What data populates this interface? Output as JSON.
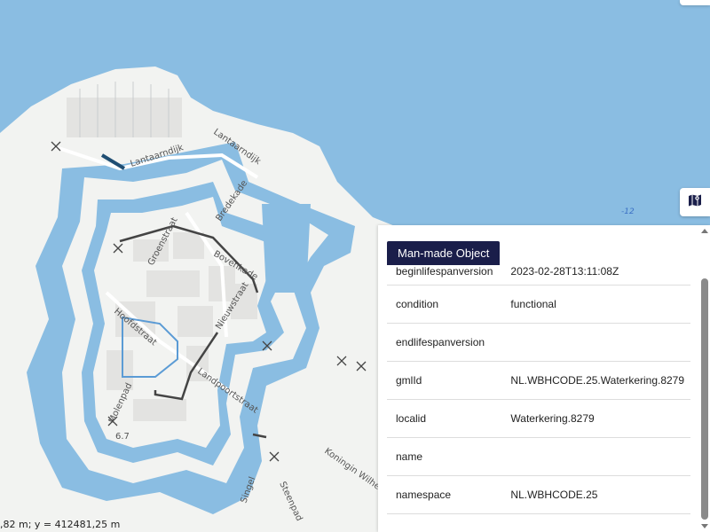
{
  "map": {
    "street_labels": {
      "lantaarndijk_1": "Lantaarndijk",
      "lantaarndijk_2": "Lantaarndijk",
      "bredekade": "Bredekade",
      "groenstraat": "Groenstraat",
      "bovenkade": "Bovenkade",
      "hoofdstraat": "Hoofdstraat",
      "nieuwstraat": "Nieuwstraat",
      "landpoortstraat": "Landpoortstraat",
      "molenpad": "Molenpad",
      "singel": "Singel",
      "steenpad": "Steenpad",
      "koningin": "Koningin Wilhelm"
    },
    "depth_label": "-12",
    "spot_height": "6.7"
  },
  "coordinates": ",82 m; y = 412481,25 m",
  "map_button_icon": "map-icon",
  "panel": {
    "title": "Man-made Object",
    "rows": [
      {
        "key": "beginlifespanversion",
        "value": "2023-02-28T13:11:08Z"
      },
      {
        "key": "condition",
        "value": "functional"
      },
      {
        "key": "endlifespanversion",
        "value": ""
      },
      {
        "key": "gmlId",
        "value": "NL.WBHCODE.25.Waterkering.8279"
      },
      {
        "key": "localid",
        "value": "Waterkering.8279"
      },
      {
        "key": "name",
        "value": ""
      },
      {
        "key": "namespace",
        "value": "NL.WBHCODE.25"
      }
    ]
  },
  "colors": {
    "water": "#8abde2",
    "land": "#f2f3f1",
    "buildings": "#e4e4e2",
    "panel_tab": "#1a1e4a"
  }
}
